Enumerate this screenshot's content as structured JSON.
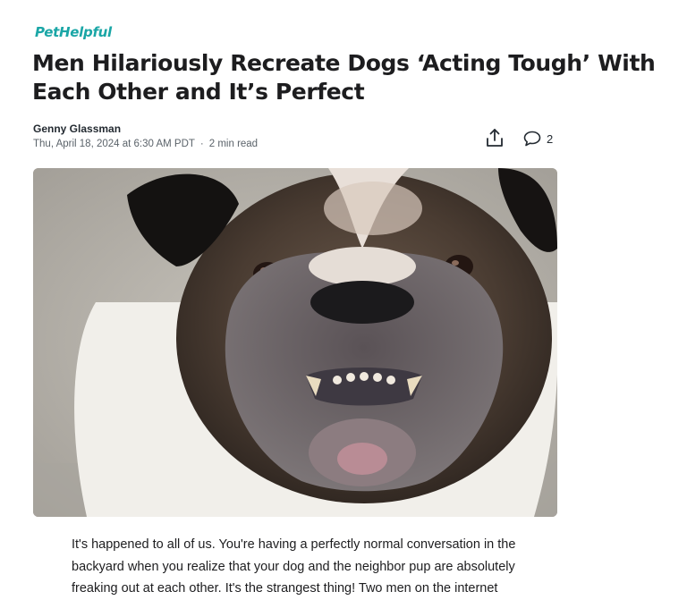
{
  "brand": "PetHelpful",
  "article": {
    "headline": "Men Hilariously Recreate Dogs ‘Acting Tough’ With Each Other and It’s Perfect",
    "author": "Genny Glassman",
    "date": "Thu, April 18, 2024 at 6:30 AM PDT",
    "read_time": "2 min read",
    "comment_count": "2",
    "image_subject": "close-up of an English bulldog with bottom teeth showing",
    "body": "It's happened to all of us. You're having a perfectly normal conversation in the backyard when you realize that your dog and the neighbor pup are absolutely freaking out at each other. It's the strangest thing! Two men on the internet"
  },
  "icons": {
    "share": "share-icon",
    "comment": "comment-icon"
  },
  "colors": {
    "brand": "#1aa6a6",
    "text": "#1d1d1f",
    "meta": "#5b636a"
  }
}
